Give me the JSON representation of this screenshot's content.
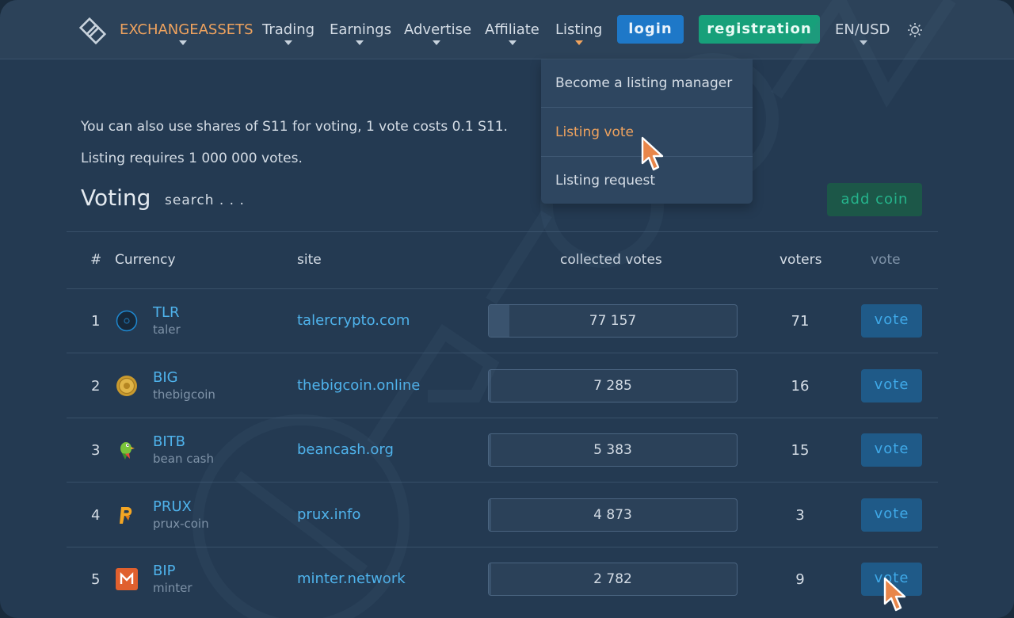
{
  "header": {
    "brand": "EXCHANGEASSETS",
    "nav": [
      {
        "label": "Trading"
      },
      {
        "label": "Earnings"
      },
      {
        "label": "Advertise"
      },
      {
        "label": "Affiliate"
      },
      {
        "label": "Listing"
      }
    ],
    "login_label": "login",
    "registration_label": "registration",
    "lang_label": "EN",
    "currency_label": "USD"
  },
  "dropdown": {
    "items": [
      {
        "label": "Become a listing manager"
      },
      {
        "label": "Listing vote"
      },
      {
        "label": "Listing request"
      }
    ]
  },
  "info": {
    "line1": "You can also use shares of S11 for voting, 1 vote costs 0.1 S11.",
    "line2": "Listing requires 1 000 000 votes."
  },
  "voting": {
    "title": "Voting",
    "search_placeholder": "search . . .",
    "add_coin_label": "add coin"
  },
  "table": {
    "headers": {
      "num": "#",
      "currency": "Currency",
      "site": "site",
      "collected": "collected votes",
      "voters": "voters",
      "vote": "vote"
    },
    "rows": [
      {
        "num": "1",
        "ticker": "TLR",
        "name": "taler",
        "site": "talercrypto.com",
        "votes": "77 157",
        "progress": 0.077,
        "voters": "71",
        "vote_label": "vote"
      },
      {
        "num": "2",
        "ticker": "BIG",
        "name": "thebigcoin",
        "site": "thebigcoin.online",
        "votes": "7 285",
        "progress": 0.0073,
        "voters": "16",
        "vote_label": "vote"
      },
      {
        "num": "3",
        "ticker": "BITB",
        "name": "bean cash",
        "site": "beancash.org",
        "votes": "5 383",
        "progress": 0.0054,
        "voters": "15",
        "vote_label": "vote"
      },
      {
        "num": "4",
        "ticker": "PRUX",
        "name": "prux-coin",
        "site": "prux.info",
        "votes": "4 873",
        "progress": 0.0049,
        "voters": "3",
        "vote_label": "vote"
      },
      {
        "num": "5",
        "ticker": "BIP",
        "name": "minter",
        "site": "minter.network",
        "votes": "2 782",
        "progress": 0.0028,
        "voters": "9",
        "vote_label": "vote"
      }
    ]
  },
  "colors": {
    "background": "#243a52",
    "header": "#2c4259",
    "accent_orange": "#f0a35e",
    "link_blue": "#4fb3ec",
    "login_blue": "#1e78c8",
    "registration_green": "#17a07a"
  },
  "icons": {
    "logo": "exchange-logo-icon",
    "theme": "sun-icon",
    "cursor": "pointer-cursor-icon",
    "watermark": "picoin-watermark"
  }
}
